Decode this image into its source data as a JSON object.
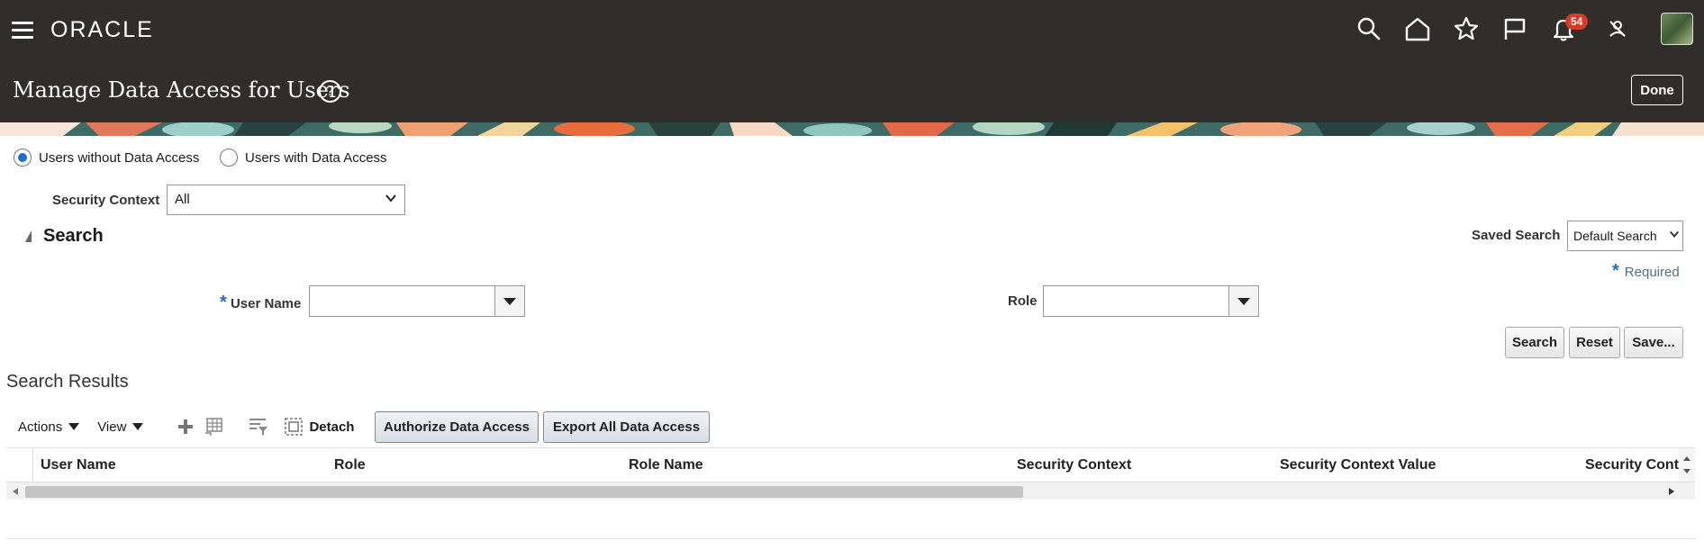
{
  "header": {
    "logo": "ORACLE",
    "notification_count": "54",
    "icons": [
      "search-icon",
      "home-icon",
      "star-icon",
      "flag-icon",
      "bell-icon",
      "user-offline-icon"
    ]
  },
  "page": {
    "title": "Manage Data Access for Users",
    "done_label": "Done"
  },
  "filter": {
    "radio_without": "Users without Data Access",
    "radio_with": "Users with Data Access",
    "security_context_label": "Security Context",
    "security_context_value": "All"
  },
  "search": {
    "title": "Search",
    "saved_search_label": "Saved Search",
    "saved_search_value": "Default Search",
    "required_text": "Required",
    "user_name_label": "User Name",
    "role_label": "Role",
    "search_button": "Search",
    "reset_button": "Reset",
    "save_button": "Save..."
  },
  "results": {
    "title": "Search Results",
    "actions_label": "Actions",
    "view_label": "View",
    "detach_label": "Detach",
    "authorize_button": "Authorize Data Access",
    "export_button": "Export All Data Access",
    "columns": [
      "User Name",
      "Role",
      "Role Name",
      "Security Context",
      "Security Context Value",
      "Security Cont"
    ]
  },
  "colors": {
    "header_bg": "#312d2a",
    "accent": "#1e6fc8",
    "badge": "#d23c28"
  }
}
